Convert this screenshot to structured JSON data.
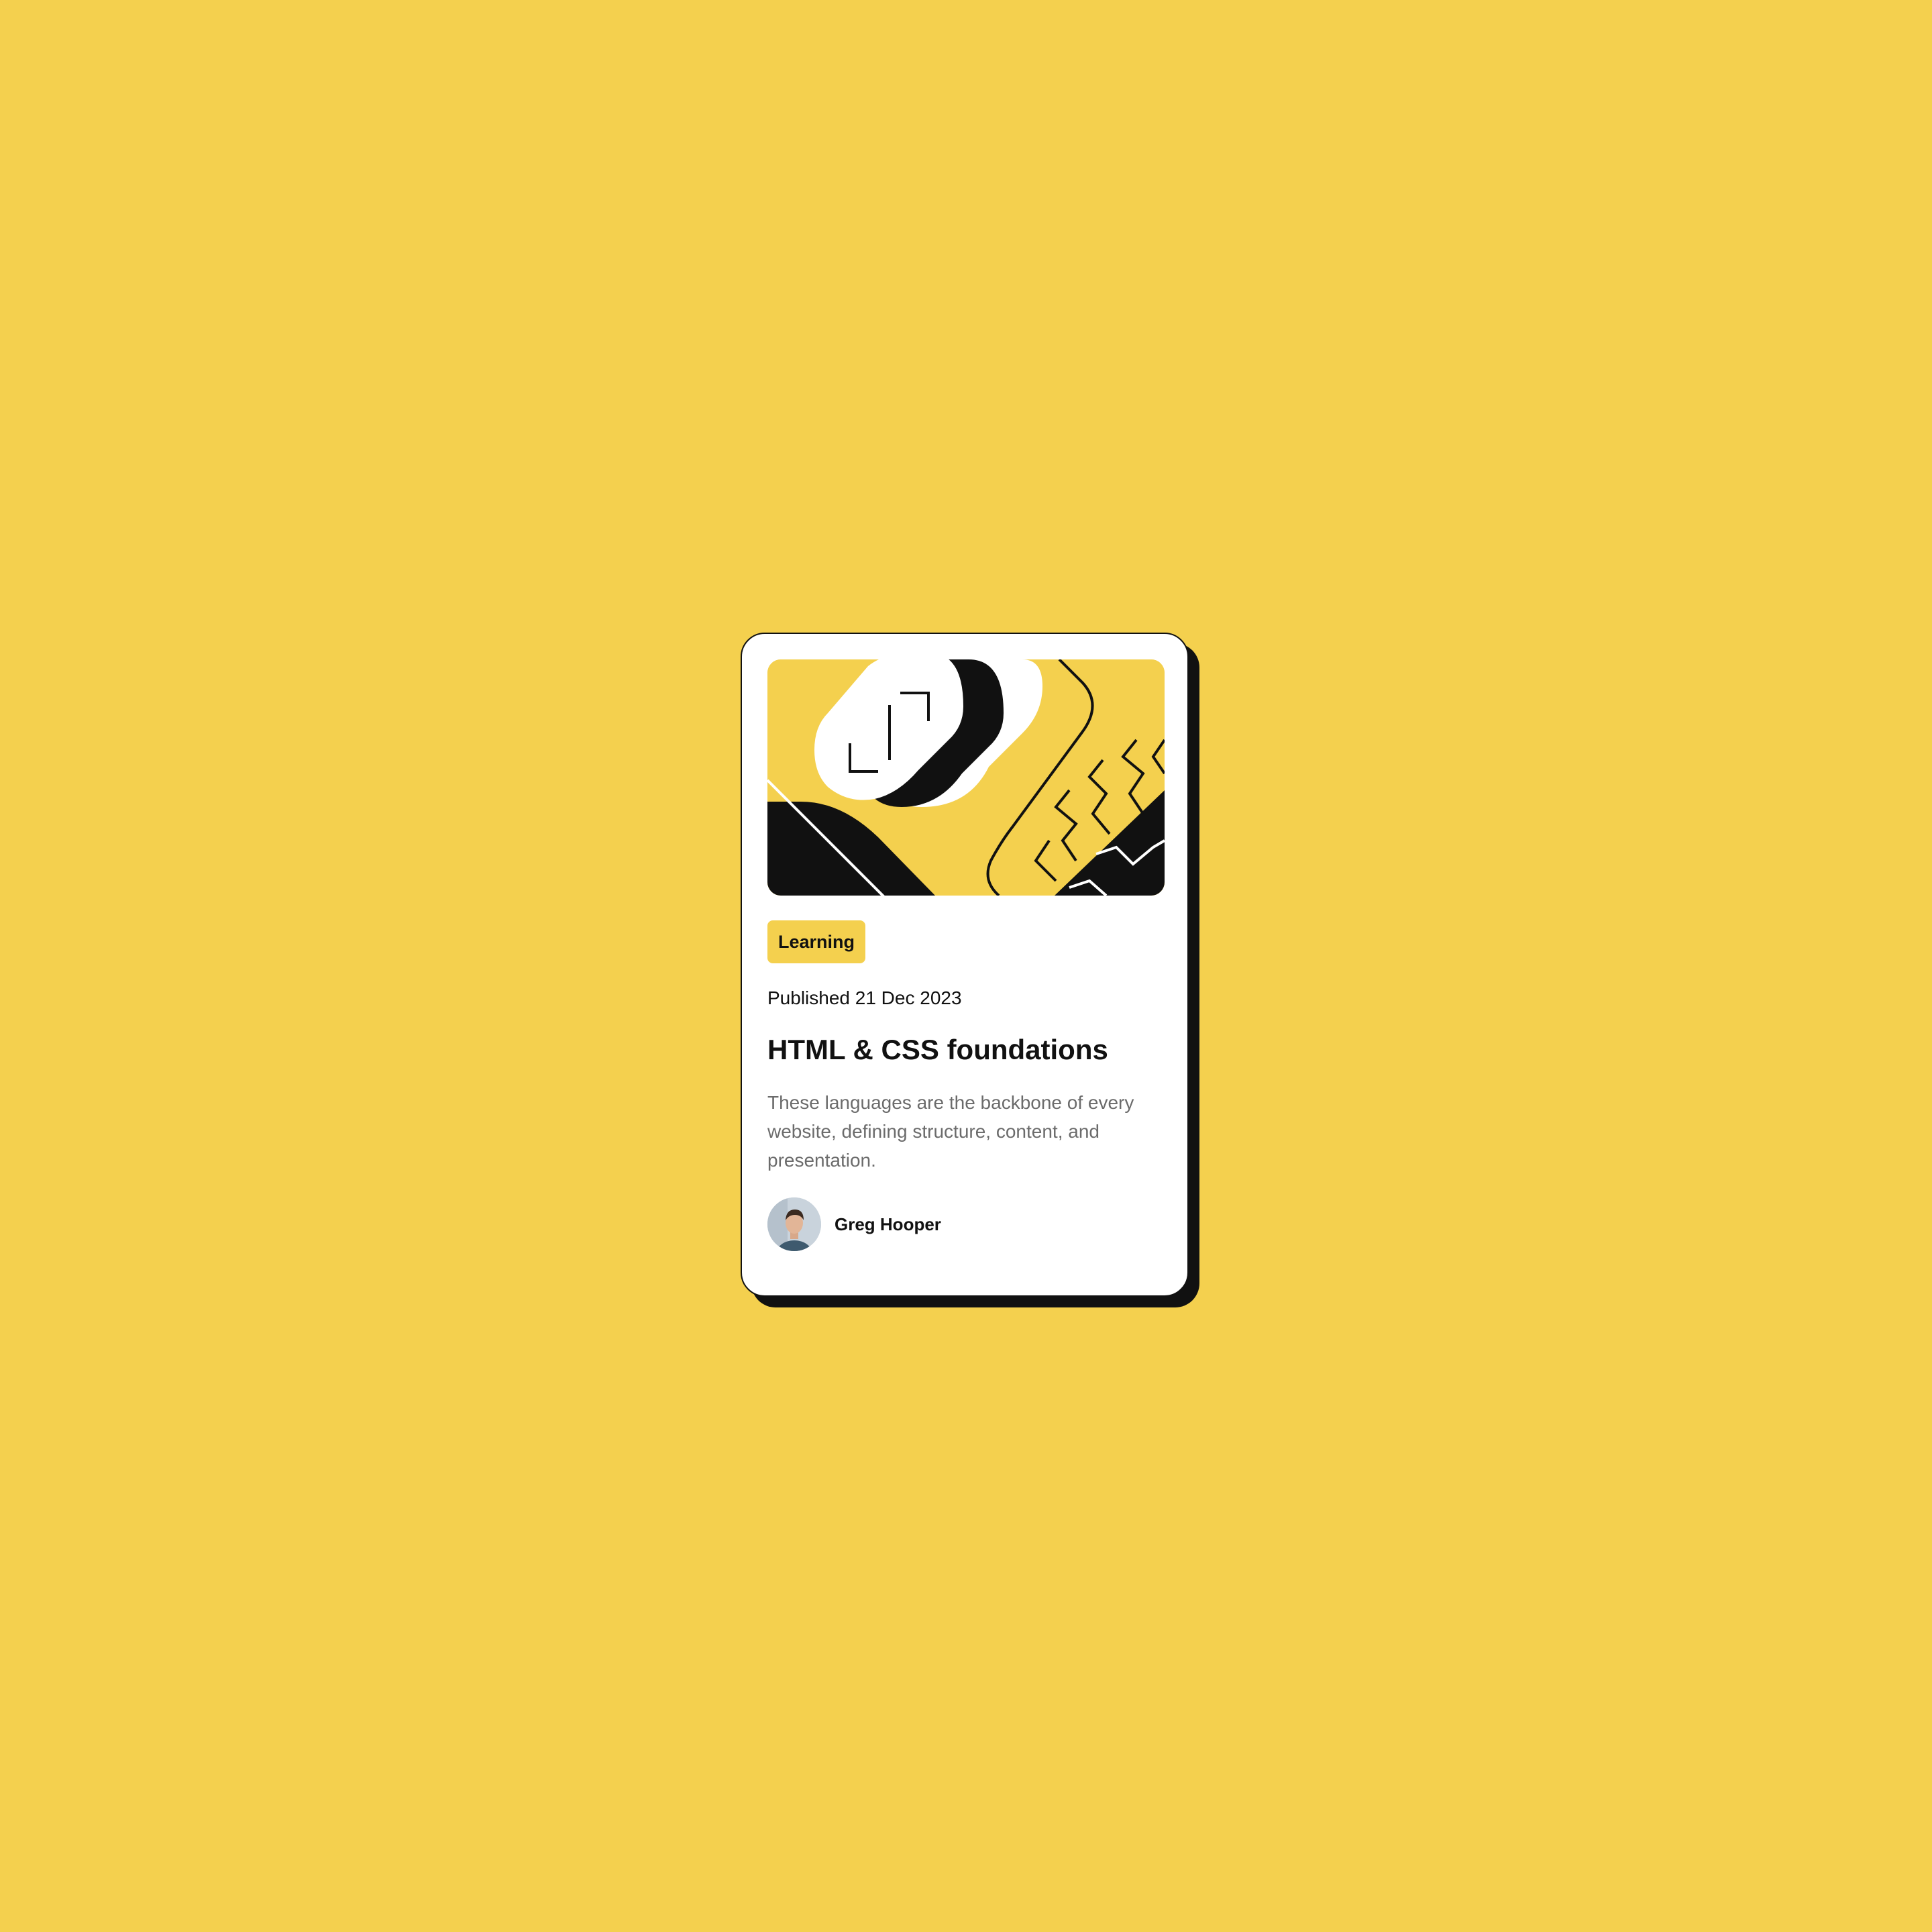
{
  "colors": {
    "background": "#F4D04E",
    "card": "#FFFFFF",
    "ink": "#111111",
    "muted_text": "#6B6B6B"
  },
  "card": {
    "hero_image": "abstract-code-illustration",
    "category": "Learning",
    "published": "Published 21 Dec 2023",
    "title": "HTML & CSS foundations",
    "description": "These languages are the backbone of every website, defining structure, content, and presentation.",
    "author": {
      "name": "Greg Hooper",
      "avatar": "author-avatar-photo"
    }
  }
}
